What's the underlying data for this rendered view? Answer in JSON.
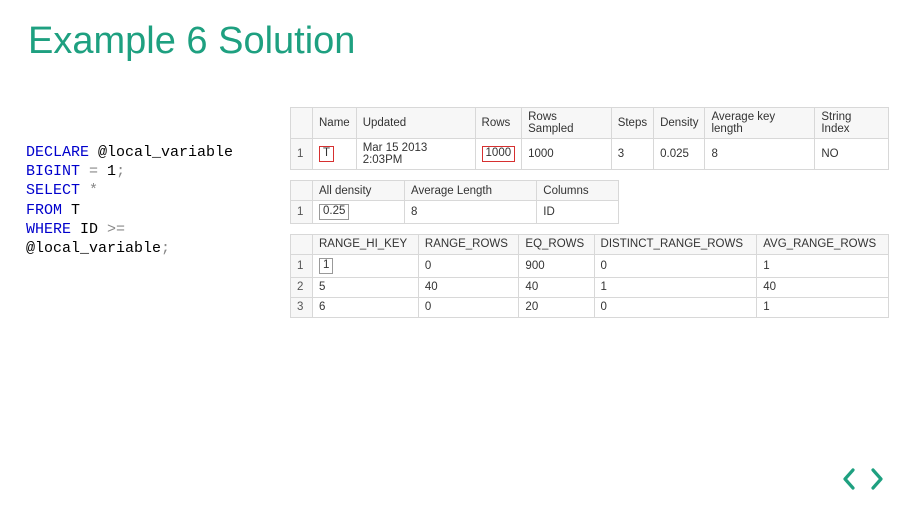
{
  "title": "Example 6 Solution",
  "code": {
    "l1a": "DECLARE",
    "l1b": " @local_variable",
    "l2a": "BIGINT",
    "l2b": " ",
    "l2c": "=",
    "l2d": " 1",
    "l2e": ";",
    "l3a": "SELECT",
    "l3b": " ",
    "l3c": "*",
    "l4a": "FROM",
    "l4b": " T",
    "l5a": "WHERE",
    "l5b": " ID ",
    "l5c": ">=",
    "l6a": "@local_variable",
    "l6b": ";"
  },
  "table1": {
    "headers": [
      "",
      "Name",
      "Updated",
      "Rows",
      "Rows Sampled",
      "Steps",
      "Density",
      "Average key length",
      "String Index"
    ],
    "rows": [
      [
        "1",
        "T",
        "Mar 15 2013  2:03PM",
        "1000",
        "1000",
        "3",
        "0.025",
        "8",
        "NO"
      ]
    ]
  },
  "table2": {
    "headers": [
      "",
      "All density",
      "Average Length",
      "Columns"
    ],
    "rows": [
      [
        "1",
        "0.25",
        "8",
        "ID"
      ]
    ]
  },
  "table3": {
    "headers": [
      "",
      "RANGE_HI_KEY",
      "RANGE_ROWS",
      "EQ_ROWS",
      "DISTINCT_RANGE_ROWS",
      "AVG_RANGE_ROWS"
    ],
    "rows": [
      [
        "1",
        "1",
        "0",
        "900",
        "0",
        "1"
      ],
      [
        "2",
        "5",
        "40",
        "40",
        "1",
        "40"
      ],
      [
        "3",
        "6",
        "0",
        "20",
        "0",
        "1"
      ]
    ]
  }
}
